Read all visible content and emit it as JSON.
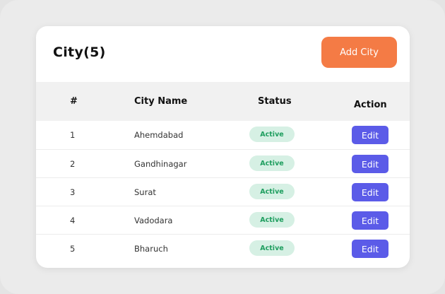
{
  "header": {
    "title": "City(5)",
    "add_label": "Add City"
  },
  "table": {
    "columns": [
      "#",
      "City Name",
      "Status",
      "Action"
    ],
    "rows": [
      {
        "num": "1",
        "city": "Ahemdabad",
        "status": "Active",
        "action": "Edit"
      },
      {
        "num": "2",
        "city": "Gandhinagar",
        "status": "Active",
        "action": "Edit"
      },
      {
        "num": "3",
        "city": "Surat",
        "status": "Active",
        "action": "Edit"
      },
      {
        "num": "4",
        "city": "Vadodara",
        "status": "Active",
        "action": "Edit"
      },
      {
        "num": "5",
        "city": "Bharuch",
        "status": "Active",
        "action": "Edit"
      }
    ]
  },
  "colors": {
    "accent": "#f47b45",
    "edit": "#5b5be8",
    "status_bg": "#d6f0e4",
    "status_text": "#1f9e5f"
  }
}
